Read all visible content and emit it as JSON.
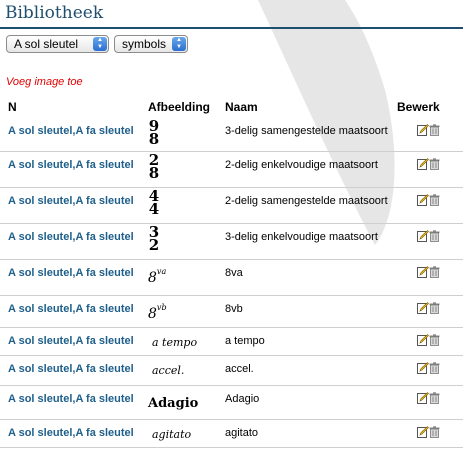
{
  "header": {
    "title": "Bibliotheek"
  },
  "filters": {
    "clef_select": "A sol sleutel",
    "type_select": "symbols"
  },
  "add_link": "Voeg image toe",
  "columns": {
    "n": "N",
    "afbeelding": "Afbeelding",
    "naam": "Naam",
    "bewerk": "Bewerk"
  },
  "rows": [
    {
      "n": "A sol sleutel,A fa sleutel",
      "image": [
        "9",
        "8"
      ],
      "image_kind": "time-signature",
      "naam": "3-delig samengestelde maatsoort"
    },
    {
      "n": "A sol sleutel,A fa sleutel",
      "image": [
        "2",
        "8"
      ],
      "image_kind": "time-signature",
      "naam": "2-delig enkelvoudige maatsoort"
    },
    {
      "n": "A sol sleutel,A fa sleutel",
      "image": [
        "4",
        "4"
      ],
      "image_kind": "time-signature",
      "naam": "2-delig samengestelde maatsoort"
    },
    {
      "n": "A sol sleutel,A fa sleutel",
      "image": [
        "3",
        "2"
      ],
      "image_kind": "time-signature",
      "naam": "3-delig enkelvoudige maatsoort"
    },
    {
      "n": "A sol sleutel,A fa sleutel",
      "image": [
        "8",
        "va"
      ],
      "image_kind": "octave",
      "naam": "8va"
    },
    {
      "n": "A sol sleutel,A fa sleutel",
      "image": [
        "8",
        "vb"
      ],
      "image_kind": "octave",
      "naam": "8vb"
    },
    {
      "n": "A sol sleutel,A fa sleutel",
      "image": [
        "a tempo"
      ],
      "image_kind": "italic-text",
      "naam": "a tempo"
    },
    {
      "n": "A sol sleutel,A fa sleutel",
      "image": [
        "accel."
      ],
      "image_kind": "italic-text",
      "naam": "accel."
    },
    {
      "n": "A sol sleutel,A fa sleutel",
      "image": [
        "Adagio"
      ],
      "image_kind": "bold-text",
      "naam": "Adagio"
    },
    {
      "n": "A sol sleutel,A fa sleutel",
      "image": [
        "agitato"
      ],
      "image_kind": "italic-text",
      "naam": "agitato"
    }
  ],
  "icons": {
    "edit": "edit-pencil-icon",
    "delete": "trash-icon",
    "watermark": "watermark-swoosh"
  },
  "colors": {
    "title": "#1e4f6e",
    "link": "#1e5f8c",
    "add_link": "#e00000"
  }
}
